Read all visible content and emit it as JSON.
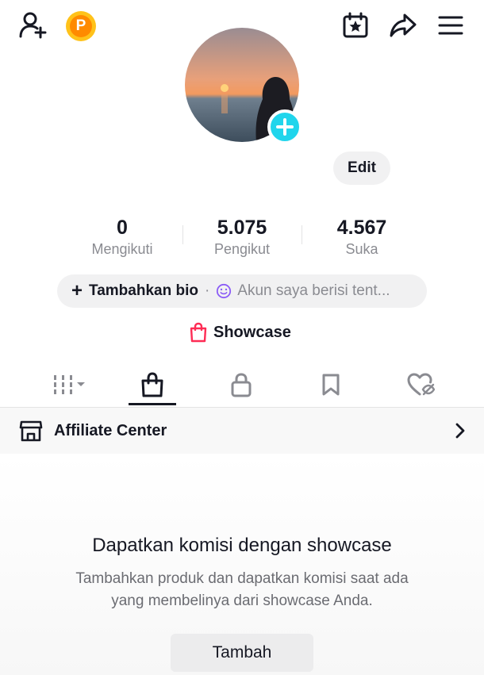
{
  "topbar": {
    "add_friend_icon": "person-plus-icon",
    "coin_letter": "P",
    "calendar_icon": "calendar-star-icon",
    "share_icon": "share-arrow-icon",
    "menu_icon": "hamburger-menu-icon"
  },
  "profile": {
    "edit_label": "Edit",
    "avatar_add_icon": "plus-icon"
  },
  "stats": [
    {
      "value": "0",
      "label": "Mengikuti"
    },
    {
      "value": "5.075",
      "label": "Pengikut"
    },
    {
      "value": "4.567",
      "label": "Suka"
    }
  ],
  "bio": {
    "add_label": "Tambahkan bio",
    "separator": "·",
    "hint": "Akun saya berisi tent..."
  },
  "showcase": {
    "label": "Showcase"
  },
  "tabs": [
    {
      "icon": "grid-videos-icon",
      "active": false
    },
    {
      "icon": "shopping-bag-icon",
      "active": true
    },
    {
      "icon": "lock-icon",
      "active": false
    },
    {
      "icon": "bookmark-icon",
      "active": false
    },
    {
      "icon": "liked-hidden-heart-icon",
      "active": false
    }
  ],
  "affiliate": {
    "label": "Affiliate Center"
  },
  "empty_state": {
    "title": "Dapatkan komisi dengan showcase",
    "description_line1": "Tambahkan produk dan dapatkan komisi saat ada",
    "description_line2": "yang membelinya dari showcase Anda.",
    "button_label": "Tambah"
  },
  "colors": {
    "accent_cyan": "#20d5ec",
    "text_primary": "#161823",
    "text_secondary": "#8a8b91",
    "showcase_bag": "#fe2c55",
    "coin": "#ffc21a"
  }
}
